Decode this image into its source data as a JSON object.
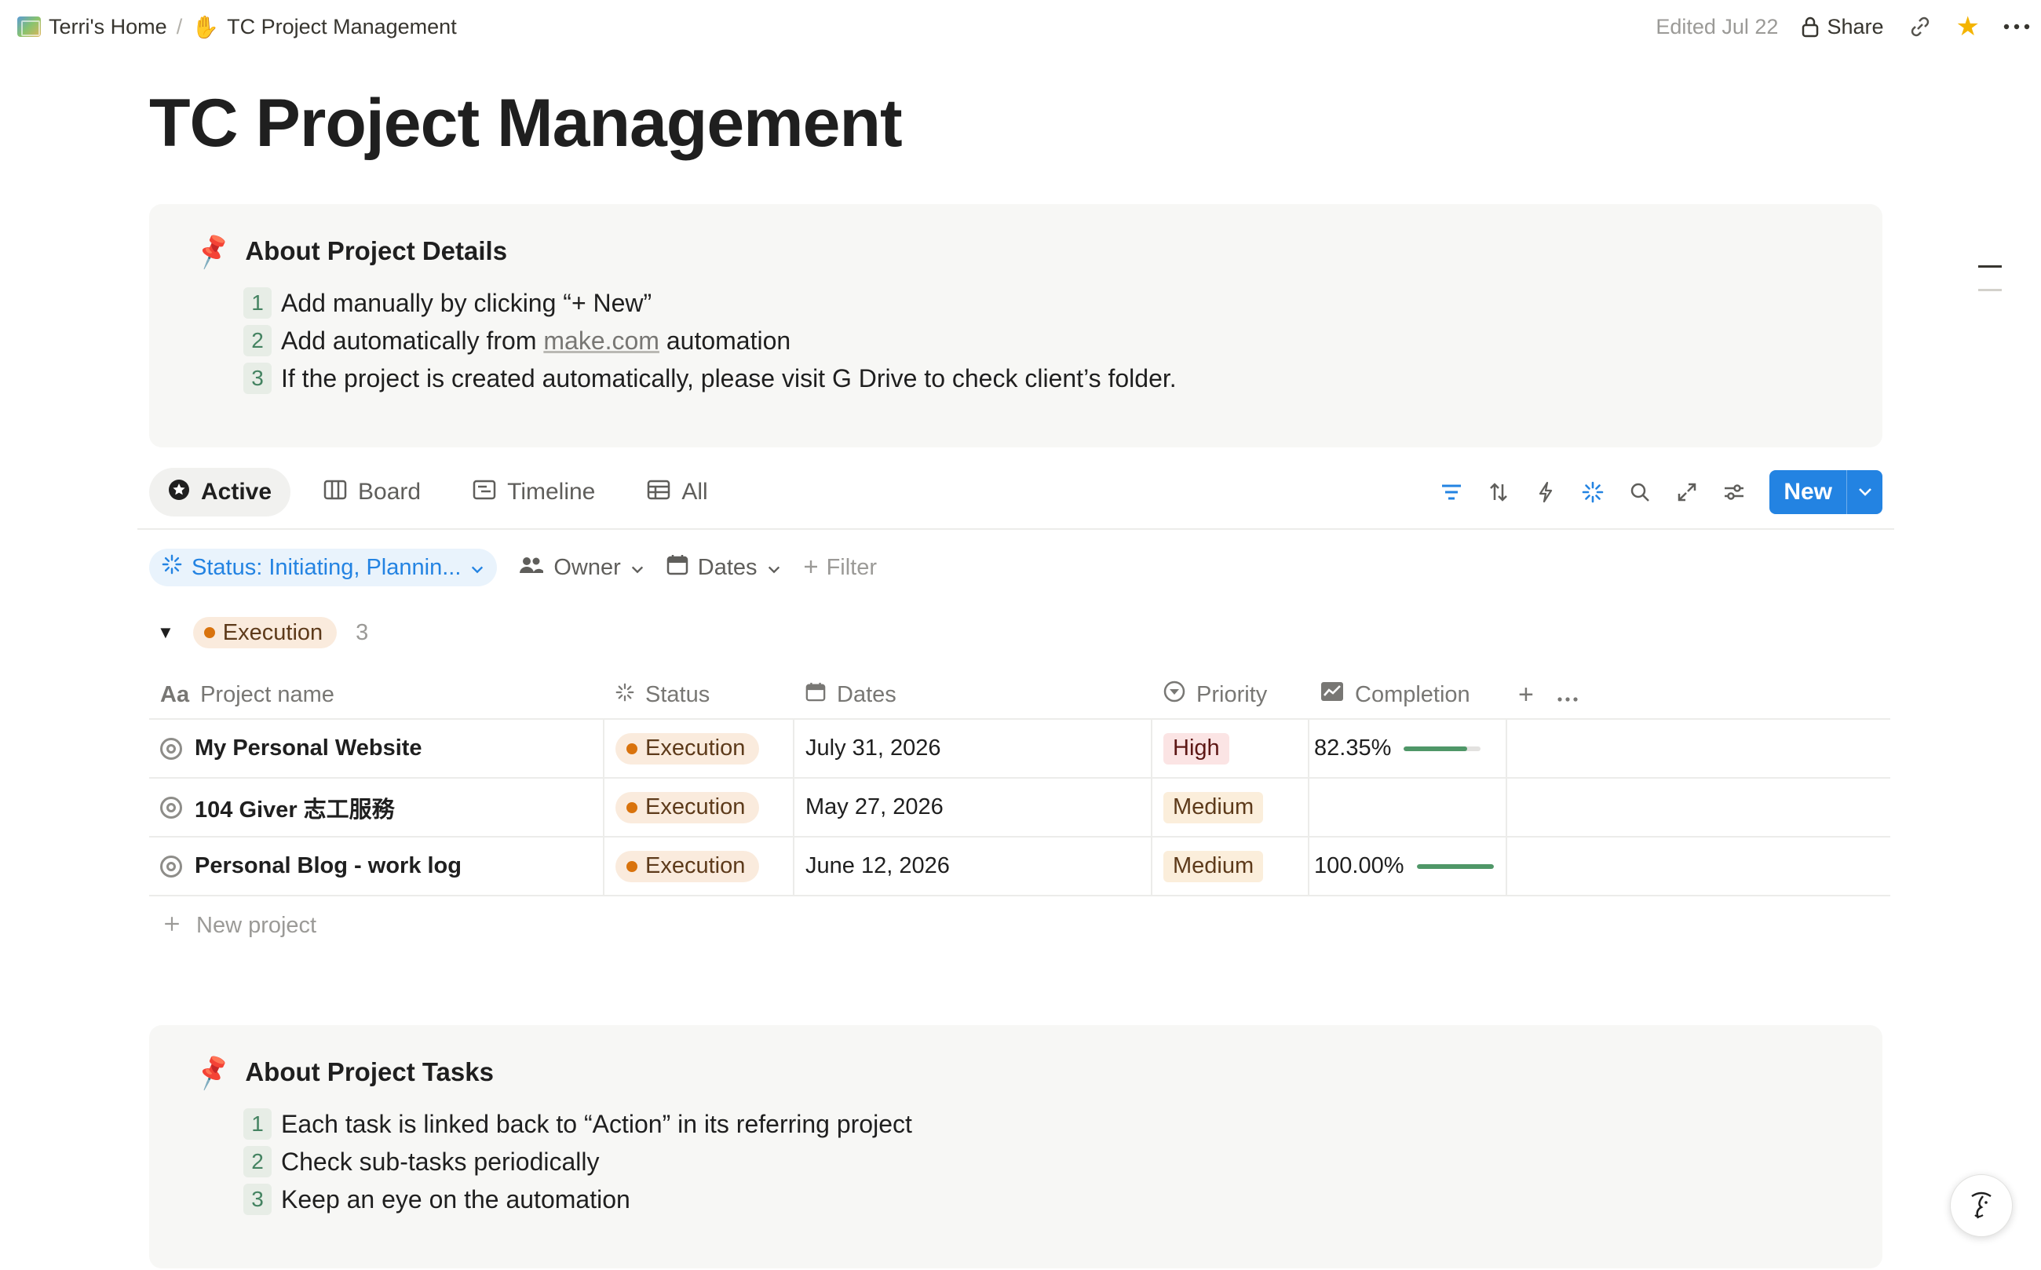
{
  "breadcrumb": {
    "home": "Terri's Home",
    "separator": "/",
    "current": "TC Project Management"
  },
  "topbar": {
    "edited": "Edited Jul 22",
    "share": "Share"
  },
  "page": {
    "title": "TC Project Management"
  },
  "callout_details": {
    "heading": "About Project Details",
    "items": [
      {
        "num": "1",
        "text": "Add manually by clicking “+ New”"
      },
      {
        "num": "2",
        "text_before": "Add automatically from ",
        "link": "make.com",
        "text_after": " automation"
      },
      {
        "num": "3",
        "text": "If the project is created automatically, please visit G Drive to check client’s folder."
      }
    ]
  },
  "views": {
    "tabs": [
      {
        "label": "Active",
        "icon": "star-circle-icon",
        "active": true
      },
      {
        "label": "Board",
        "icon": "board-icon",
        "active": false
      },
      {
        "label": "Timeline",
        "icon": "timeline-icon",
        "active": false
      },
      {
        "label": "All",
        "icon": "table-icon",
        "active": false
      }
    ],
    "new_label": "New"
  },
  "filters": {
    "status": "Status: Initiating, Plannin...",
    "owner": "Owner",
    "dates": "Dates",
    "add": "Filter"
  },
  "group": {
    "label": "Execution",
    "count": "3"
  },
  "table": {
    "columns": {
      "name": "Project name",
      "name_prefix": "Aa",
      "status": "Status",
      "dates": "Dates",
      "priority": "Priority",
      "completion": "Completion"
    },
    "rows": [
      {
        "name": "My Personal Website",
        "status": "Execution",
        "date": "July 31, 2026",
        "priority": "High",
        "completion": "82.35%",
        "completion_value": 0.8235
      },
      {
        "name": "104 Giver 志工服務",
        "status": "Execution",
        "date": "May 27, 2026",
        "priority": "Medium",
        "completion": "",
        "completion_value": null
      },
      {
        "name": "Personal Blog - work log",
        "status": "Execution",
        "date": "June 12, 2026",
        "priority": "Medium",
        "completion": "100.00%",
        "completion_value": 1.0
      }
    ],
    "new_row": "New project"
  },
  "callout_tasks": {
    "heading": "About Project Tasks",
    "items": [
      {
        "num": "1",
        "text": "Each task is linked back to “Action” in its referring project"
      },
      {
        "num": "2",
        "text": "Check sub-tasks periodically"
      },
      {
        "num": "3",
        "text": "Keep an eye on the automation"
      }
    ]
  },
  "colors": {
    "accent": "#2383e2",
    "execution_bg": "#faebdd",
    "execution_dot": "#d9730d",
    "high_bg": "#fbe4e4",
    "medium_bg": "#fbeedb",
    "progress": "#4f9768"
  }
}
